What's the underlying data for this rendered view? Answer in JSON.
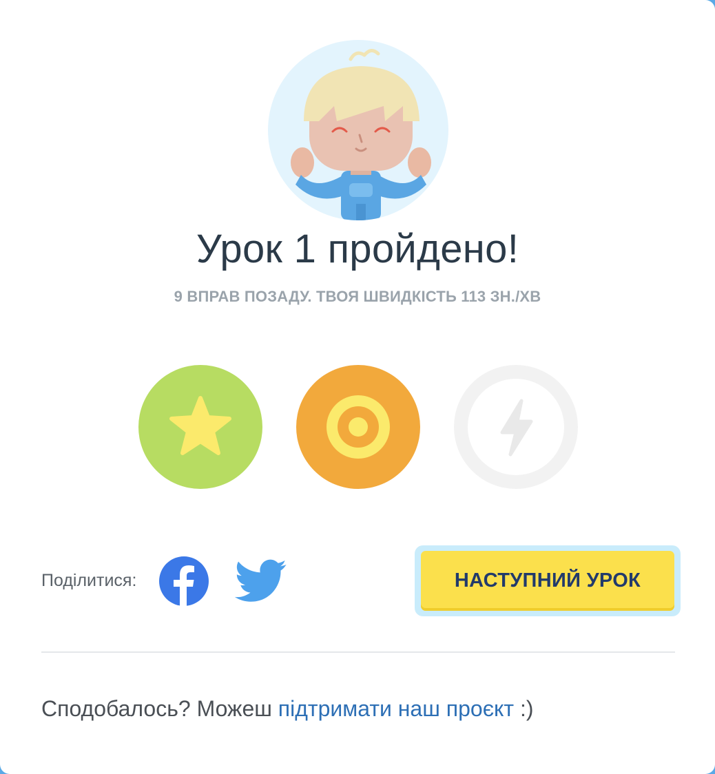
{
  "result": {
    "title": "Урок 1 пройдено!",
    "subtitle": "9 ВПРАВ ПОЗАДУ. ТВОЯ ШВИДКІСТЬ 113 ЗН./ХВ"
  },
  "badges": [
    {
      "icon": "star-icon",
      "color": "#b7dc62",
      "earned": true
    },
    {
      "icon": "target-icon",
      "color": "#f2a93c",
      "earned": true
    },
    {
      "icon": "lightning-icon",
      "color": "#f2f2f2",
      "earned": false
    }
  ],
  "share": {
    "label": "Поділитися:",
    "networks": [
      "facebook-icon",
      "twitter-icon"
    ]
  },
  "next_button": {
    "label": "НАСТУПНИЙ УРОК"
  },
  "footer": {
    "prefix": "Сподобалось? Можеш ",
    "link": "підтримати наш проєкт",
    "suffix": " :)"
  },
  "colors": {
    "accent_yellow": "#fbe04c",
    "link_blue": "#2d6fb5",
    "title_dark": "#2b3a48"
  }
}
